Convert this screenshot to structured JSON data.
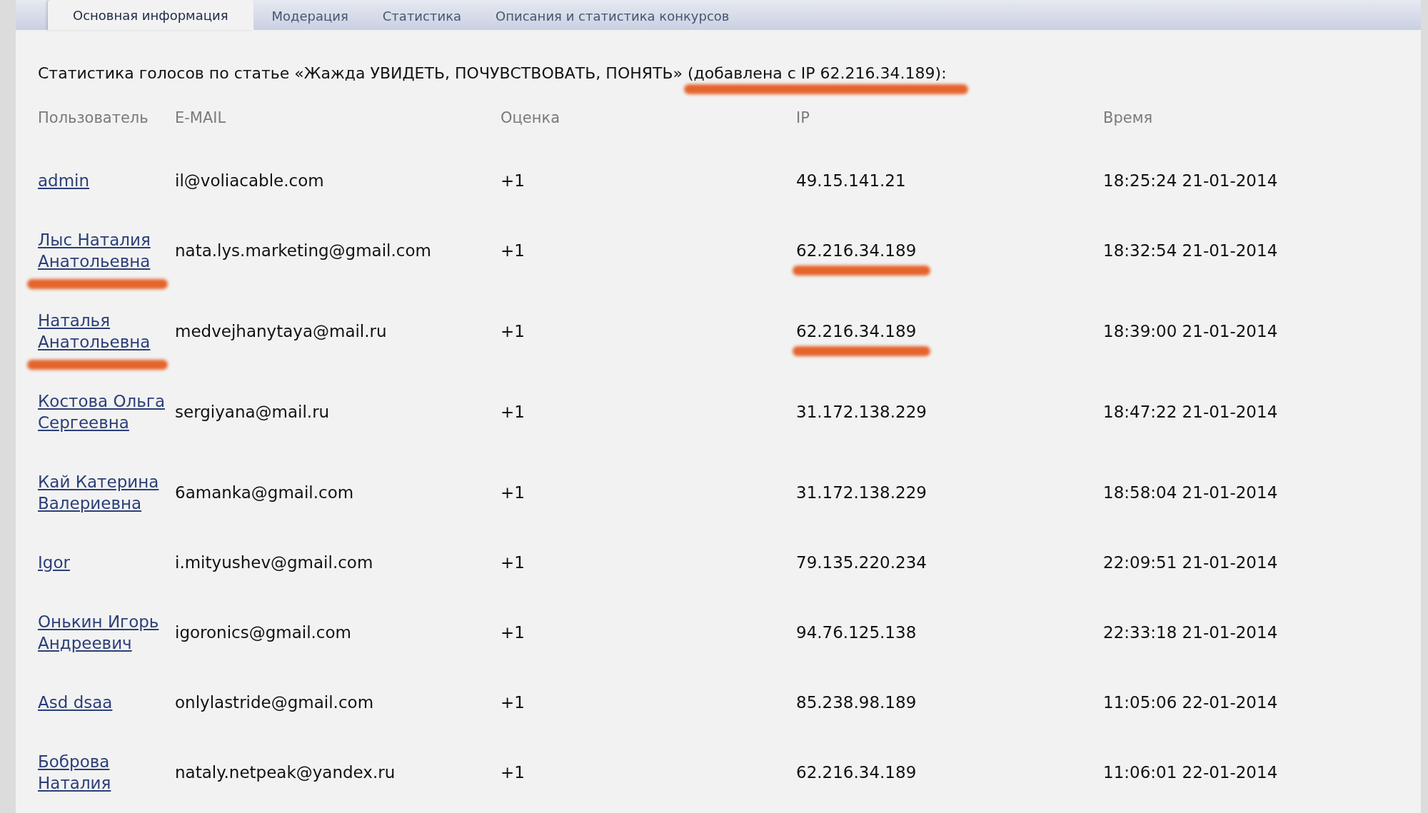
{
  "tabs": [
    {
      "label": "Основная информация",
      "selected": true
    },
    {
      "label": "Модерация",
      "selected": false
    },
    {
      "label": "Статистика",
      "selected": false
    },
    {
      "label": "Описания и статистика конкурсов",
      "selected": false
    }
  ],
  "heading": {
    "text": "Статистика голосов по статье «Жажда УВИДЕТЬ, ПОЧУВСТВОВАТЬ, ПОНЯТЬ»",
    "note": "(добавлена с IP 62.216.34.189):",
    "note_marked": true
  },
  "table": {
    "columns": [
      "Пользователь",
      "E-MAIL",
      "Оценка",
      "IP",
      "Время"
    ],
    "rows": [
      {
        "user": "admin",
        "email": "il@voliacable.com",
        "score": "+1",
        "ip": "49.15.141.21",
        "time": "18:25:24 21-01-2014",
        "user_marked": false,
        "ip_marked": false
      },
      {
        "user": "Лыс Наталия Анатольевна",
        "email": "nata.lys.marketing@gmail.com",
        "score": "+1",
        "ip": "62.216.34.189",
        "time": "18:32:54 21-01-2014",
        "user_marked": true,
        "ip_marked": true
      },
      {
        "user": "Наталья Анатольевна",
        "email": "medvejhanytaya@mail.ru",
        "score": "+1",
        "ip": "62.216.34.189",
        "time": "18:39:00 21-01-2014",
        "user_marked": true,
        "ip_marked": true
      },
      {
        "user": "Костова Ольга Сергеевна",
        "email": "sergiyana@mail.ru",
        "score": "+1",
        "ip": "31.172.138.229",
        "time": "18:47:22 21-01-2014",
        "user_marked": false,
        "ip_marked": false
      },
      {
        "user": "Кай Катерина Валериевна",
        "email": "6amanka@gmail.com",
        "score": "+1",
        "ip": "31.172.138.229",
        "time": "18:58:04 21-01-2014",
        "user_marked": false,
        "ip_marked": false
      },
      {
        "user": "Igor",
        "email": "i.mityushev@gmail.com",
        "score": "+1",
        "ip": "79.135.220.234",
        "time": "22:09:51 21-01-2014",
        "user_marked": false,
        "ip_marked": false
      },
      {
        "user": "Онькин Игорь Андреевич",
        "email": "igoronics@gmail.com",
        "score": "+1",
        "ip": "94.76.125.138",
        "time": "22:33:18 21-01-2014",
        "user_marked": false,
        "ip_marked": false
      },
      {
        "user": "Asd dsaa",
        "email": "onlylastride@gmail.com",
        "score": "+1",
        "ip": "85.238.98.189",
        "time": "11:05:06 22-01-2014",
        "user_marked": false,
        "ip_marked": false
      },
      {
        "user": "Боброва Наталия",
        "email": "nataly.netpeak@yandex.ru",
        "score": "+1",
        "ip": "62.216.34.189",
        "time": "11:06:01 22-01-2014",
        "user_marked": false,
        "ip_marked": false
      }
    ]
  }
}
